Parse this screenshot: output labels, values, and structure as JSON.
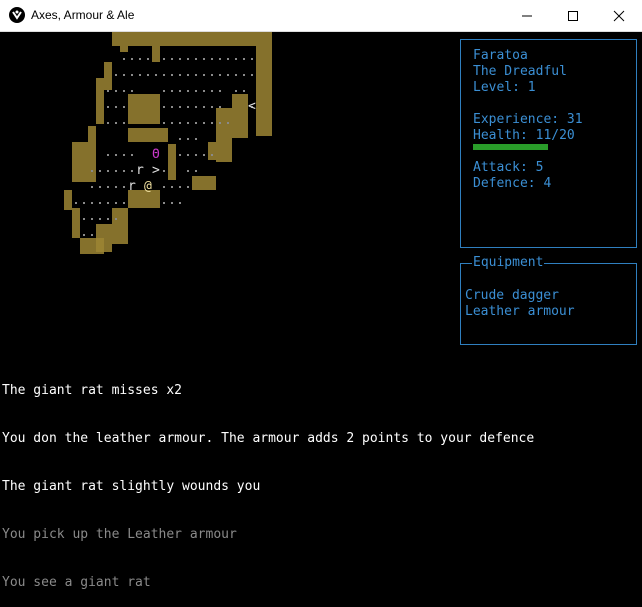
{
  "window": {
    "title": "Axes, Armour & Ale"
  },
  "character": {
    "name": "Faratoa",
    "epithet": "The Dreadful",
    "level": "Level: 1",
    "experience": "Experience: 31",
    "health": "Health: 11/20",
    "health_current": 11,
    "health_max": 20,
    "attack": "Attack: 5",
    "defence": "Defence: 4"
  },
  "equipment": {
    "title": "Equipment",
    "items": [
      "Crude dagger",
      "Leather armour"
    ]
  },
  "log": [
    {
      "text": "The giant rat misses x2",
      "style": "bright"
    },
    {
      "text": "You don the leather armour. The armour adds 2 points to your defence",
      "style": "bright"
    },
    {
      "text": "The giant rat slightly wounds you",
      "style": "bright"
    },
    {
      "text": "You pick up the Leather armour",
      "style": "dim"
    },
    {
      "text": "You see a giant rat",
      "style": "dim"
    }
  ],
  "map_glyphs": {
    "player": "@",
    "rat": "r",
    "stairs_down": ">",
    "stairs_up": "<",
    "item": "Θ"
  },
  "colors": {
    "panel_border": "#2f7fbf",
    "panel_text": "#3b8fd4",
    "health_bar": "#2a9d2a",
    "wall": "#9c8534",
    "floor": "#8a8a8a",
    "player": "#f0e0a0",
    "item": "#c838c8"
  }
}
